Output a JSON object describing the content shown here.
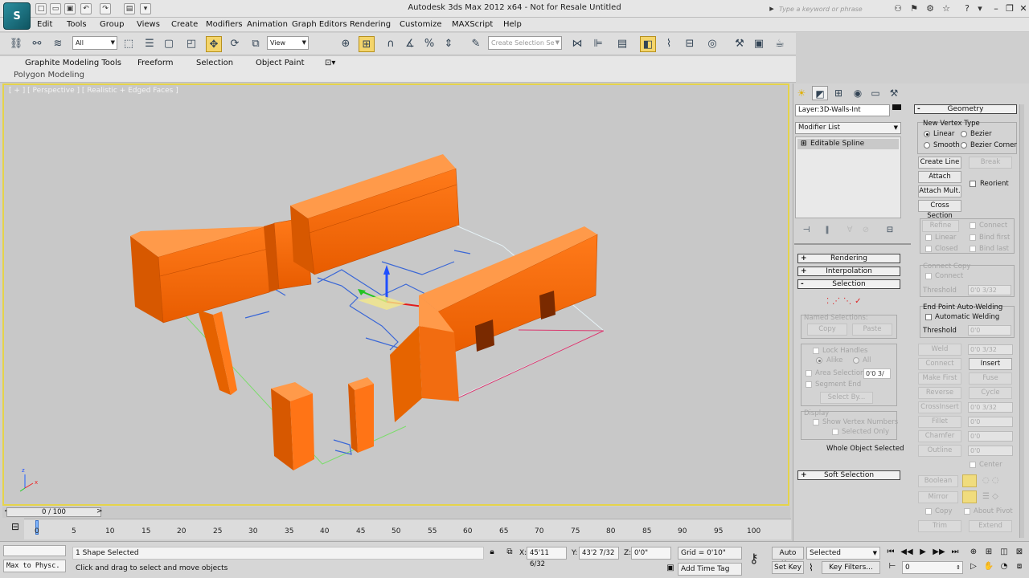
{
  "window": {
    "title": "Autodesk 3ds Max  2012 x64  -  Not for Resale   Untitled",
    "search_placeholder": "Type a keyword or phrase",
    "logo": "S"
  },
  "menu": [
    "Edit",
    "Tools",
    "Group",
    "Views",
    "Create",
    "Modifiers",
    "Animation",
    "Graph Editors",
    "Rendering",
    "Customize",
    "MAXScript",
    "Help"
  ],
  "toolbar": {
    "filter_value": "All",
    "refcoord_value": "View",
    "named_selection_placeholder": "Create Selection Se"
  },
  "ribbon": {
    "tabs": [
      "Graphite Modeling Tools",
      "Freeform",
      "Selection",
      "Object Paint"
    ],
    "sub": "Polygon Modeling"
  },
  "viewport": {
    "label": "[ + ] [ Perspective ] [ Realistic + Edged Faces ]",
    "axis_x": "x",
    "axis_z": "z"
  },
  "command_panel": {
    "layer_field": "Layer:3D-Walls-Int",
    "modifier_list": "Modifier List",
    "stack_item": "Editable Spline",
    "left_rollouts": {
      "rendering": "Rendering",
      "interpolation": "Interpolation",
      "selection": "Selection",
      "soft_selection": "Soft Selection"
    },
    "selection": {
      "named_selections": "Named Selections:",
      "copy": "Copy",
      "paste": "Paste",
      "lock_handles": "Lock Handles",
      "alike": "Alike",
      "all": "All",
      "area_selection": "Area Selection:",
      "area_value": "0'0 3/",
      "segment_end": "Segment End",
      "select_by": "Select By...",
      "display": "Display",
      "show_vertex_numbers": "Show Vertex Numbers",
      "selected_only": "Selected Only",
      "status": "Whole Object Selected"
    },
    "geometry": {
      "header": "Geometry",
      "new_vertex_type": "New Vertex Type",
      "linear": "Linear",
      "bezier": "Bezier",
      "smooth": "Smooth",
      "bezier_corner": "Bezier Corner",
      "create_line": "Create Line",
      "break": "Break",
      "attach": "Attach",
      "reorient": "Reorient",
      "attach_mult": "Attach Mult.",
      "cross_section": "Cross Section",
      "refine": "Refine",
      "connect": "Connect",
      "linear2": "Linear",
      "bind_first": "Bind first",
      "closed": "Closed",
      "bind_last": "Bind last",
      "connect_copy": "Connect Copy",
      "connect2": "Connect",
      "threshold": "Threshold",
      "threshold_value": "0'0 3/32",
      "endpoint_welding": "End Point Auto-Welding",
      "automatic_welding": "Automatic Welding",
      "threshold2": "Threshold",
      "threshold2_value": "0'0",
      "weld": "Weld",
      "weld_value": "0'0 3/32",
      "connect3": "Connect",
      "insert": "Insert",
      "make_first": "Make First",
      "fuse": "Fuse",
      "reverse": "Reverse",
      "cycle": "Cycle",
      "crossinsert": "CrossInsert",
      "crossinsert_value": "0'0 3/32",
      "fillet": "Fillet",
      "fillet_value": "0'0",
      "chamfer": "Chamfer",
      "chamfer_value": "0'0",
      "outline": "Outline",
      "outline_value": "0'0",
      "center": "Center",
      "boolean": "Boolean",
      "mirror": "Mirror",
      "copy": "Copy",
      "about_pivot": "About Pivot",
      "trim": "Trim",
      "extend": "Extend"
    }
  },
  "timeline": {
    "slider": "0 / 100",
    "ticks": [
      "0",
      "5",
      "10",
      "15",
      "20",
      "25",
      "30",
      "35",
      "40",
      "45",
      "50",
      "55",
      "60",
      "65",
      "70",
      "75",
      "80",
      "85",
      "90",
      "95",
      "100"
    ]
  },
  "status": {
    "maxscript": "Max to Physc.",
    "selection_count": "1 Shape Selected",
    "prompt": "Click and drag to select and move objects",
    "x_label": "X:",
    "x_value": "45'11 6/32",
    "y_label": "Y:",
    "y_value": "43'2 7/32",
    "z_label": "Z:",
    "z_value": "0'0\"",
    "grid": "Grid = 0'10\"",
    "add_time_tag": "Add Time Tag",
    "auto_key": "Auto Key",
    "set_key": "Set Key",
    "key_mode": "Selected",
    "key_filters": "Key Filters...",
    "frame": "0"
  }
}
